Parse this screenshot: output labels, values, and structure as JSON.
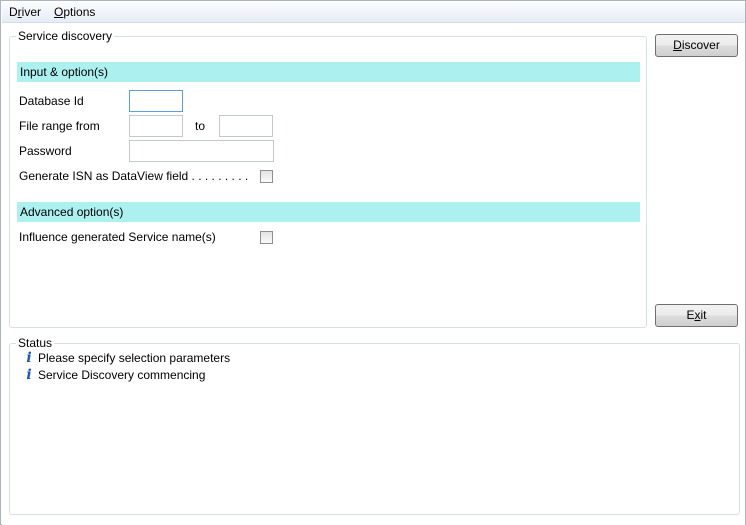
{
  "menu": {
    "driver_pre": "D",
    "driver_key": "r",
    "driver_post": "iver",
    "options_pre": "",
    "options_key": "O",
    "options_post": "ptions"
  },
  "service_discovery": {
    "title": "Service discovery",
    "input_section": "Input & option(s)",
    "database_id_label": "Database Id",
    "database_id_value": "",
    "file_range_from_label": "File range from",
    "file_range_from_value": "",
    "to_label": "to",
    "file_range_to_value": "",
    "password_label": "Password",
    "password_value": "",
    "generate_isn_label": "Generate ISN as DataView field . . . . . . . . .",
    "generate_isn_checked": false,
    "advanced_section": "Advanced option(s)",
    "influence_label": "Influence generated Service name(s)",
    "influence_checked": false
  },
  "buttons": {
    "discover_key": "D",
    "discover_rest": "iscover",
    "exit_pre": "E",
    "exit_key": "x",
    "exit_post": "it"
  },
  "status": {
    "title": "Status",
    "icon": "info-icon",
    "messages": [
      "Please specify selection parameters",
      "Service Discovery commencing"
    ]
  }
}
